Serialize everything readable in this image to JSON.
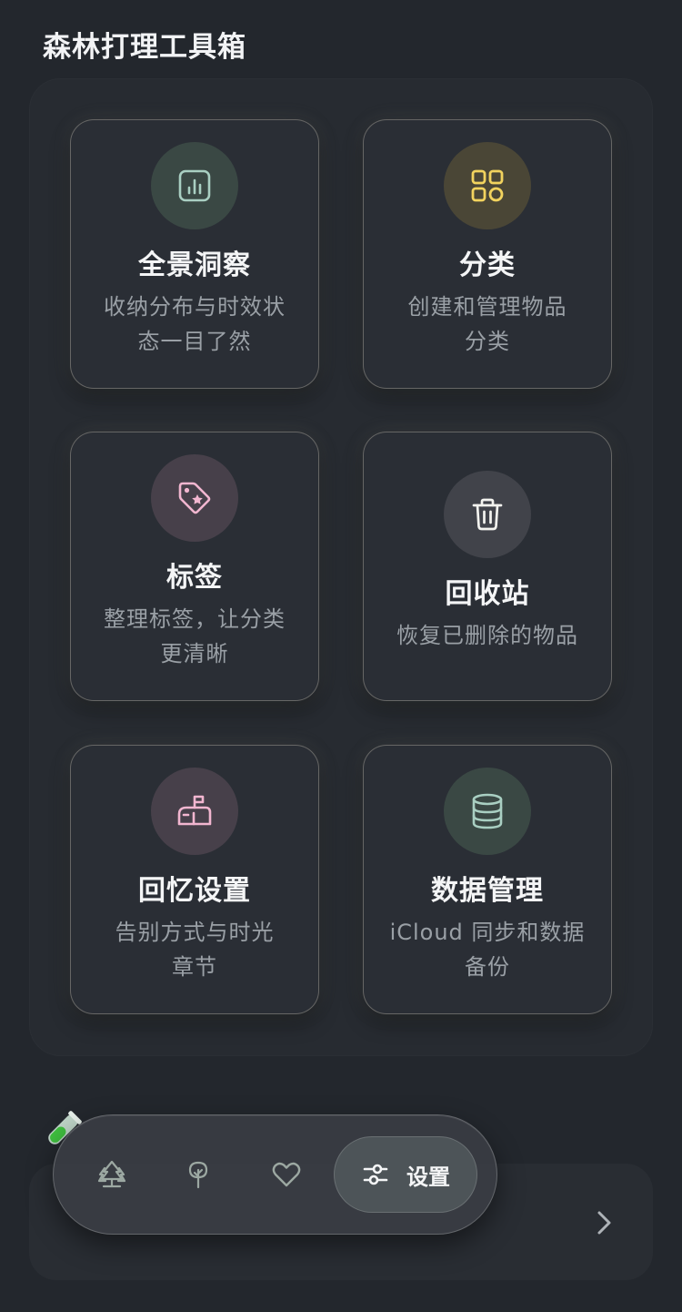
{
  "page": {
    "section_title": "森林打理工具箱"
  },
  "cards": [
    {
      "title": "全景洞察",
      "desc_line1": "收纳分布与时效状",
      "desc_line2": "态一目了然",
      "icon": "bar-chart-icon",
      "circle_color": "#3a4844",
      "icon_color": "#a9cfc2"
    },
    {
      "title": "分类",
      "desc_line1": "创建和管理物品",
      "desc_line2": "分类",
      "icon": "grid-icon",
      "circle_color": "#4a4636",
      "icon_color": "#f2d35e"
    },
    {
      "title": "标签",
      "desc_line1": "整理标签，让分类",
      "desc_line2": "更清晰",
      "icon": "tag-icon",
      "circle_color": "#47404a",
      "icon_color": "#f2b6d0"
    },
    {
      "title": "回收站",
      "desc_line1": "恢复已删除的物品",
      "icon": "trash-icon",
      "circle_color": "#41434a",
      "icon_color": "#f3f3ef"
    },
    {
      "title": "回忆设置",
      "desc_line1": "告别方式与时光",
      "desc_line2": "章节",
      "icon": "mailbox-icon",
      "circle_color": "#47404a",
      "icon_color": "#f2b6d0"
    },
    {
      "title": "数据管理",
      "desc_line1": "iCloud 同步和数据",
      "desc_line2": "备份",
      "icon": "database-icon",
      "circle_color": "#3a4844",
      "icon_color": "#a9cfc2"
    }
  ],
  "tab_bar": {
    "items": [
      {
        "icon": "forest-icon"
      },
      {
        "icon": "tree-icon"
      },
      {
        "icon": "heart-icon"
      },
      {
        "icon": "sliders-icon",
        "label": "设置",
        "active": true
      }
    ]
  },
  "colors": {
    "background": "#23272d",
    "panel": "#272b31",
    "card": "#2a2e35",
    "tab_icon": "#9ca8a2"
  }
}
